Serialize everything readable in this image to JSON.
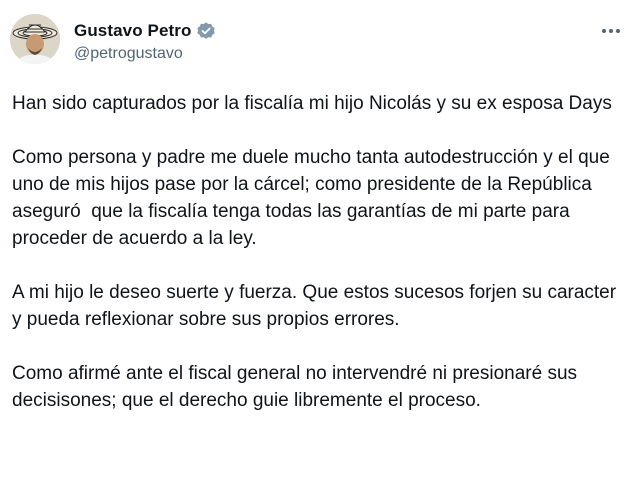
{
  "author": {
    "display_name": "Gustavo Petro",
    "handle": "@petrogustavo",
    "verified_color": "#829aab"
  },
  "icons": {
    "verified": "verified-badge-icon",
    "more": "more-options-icon"
  },
  "tweet": {
    "paragraphs": [
      "Han sido capturados por la fiscalía mi hijo Nicolás y su ex esposa Days",
      "Como persona y padre me duele mucho tanta autodestrucción y el que uno de mis hijos pase por la cárcel; como presidente de la República aseguró  que la fiscalía tenga todas las garantías de mi parte para proceder de acuerdo a la ley.",
      "A mi hijo le deseo suerte y fuerza. Que estos sucesos forjen su caracter y pueda reflexionar sobre sus propios errores.",
      "Como afirmé ante el fiscal general no intervendré ni presionaré sus decisisones; que el derecho guie libremente el proceso."
    ]
  }
}
